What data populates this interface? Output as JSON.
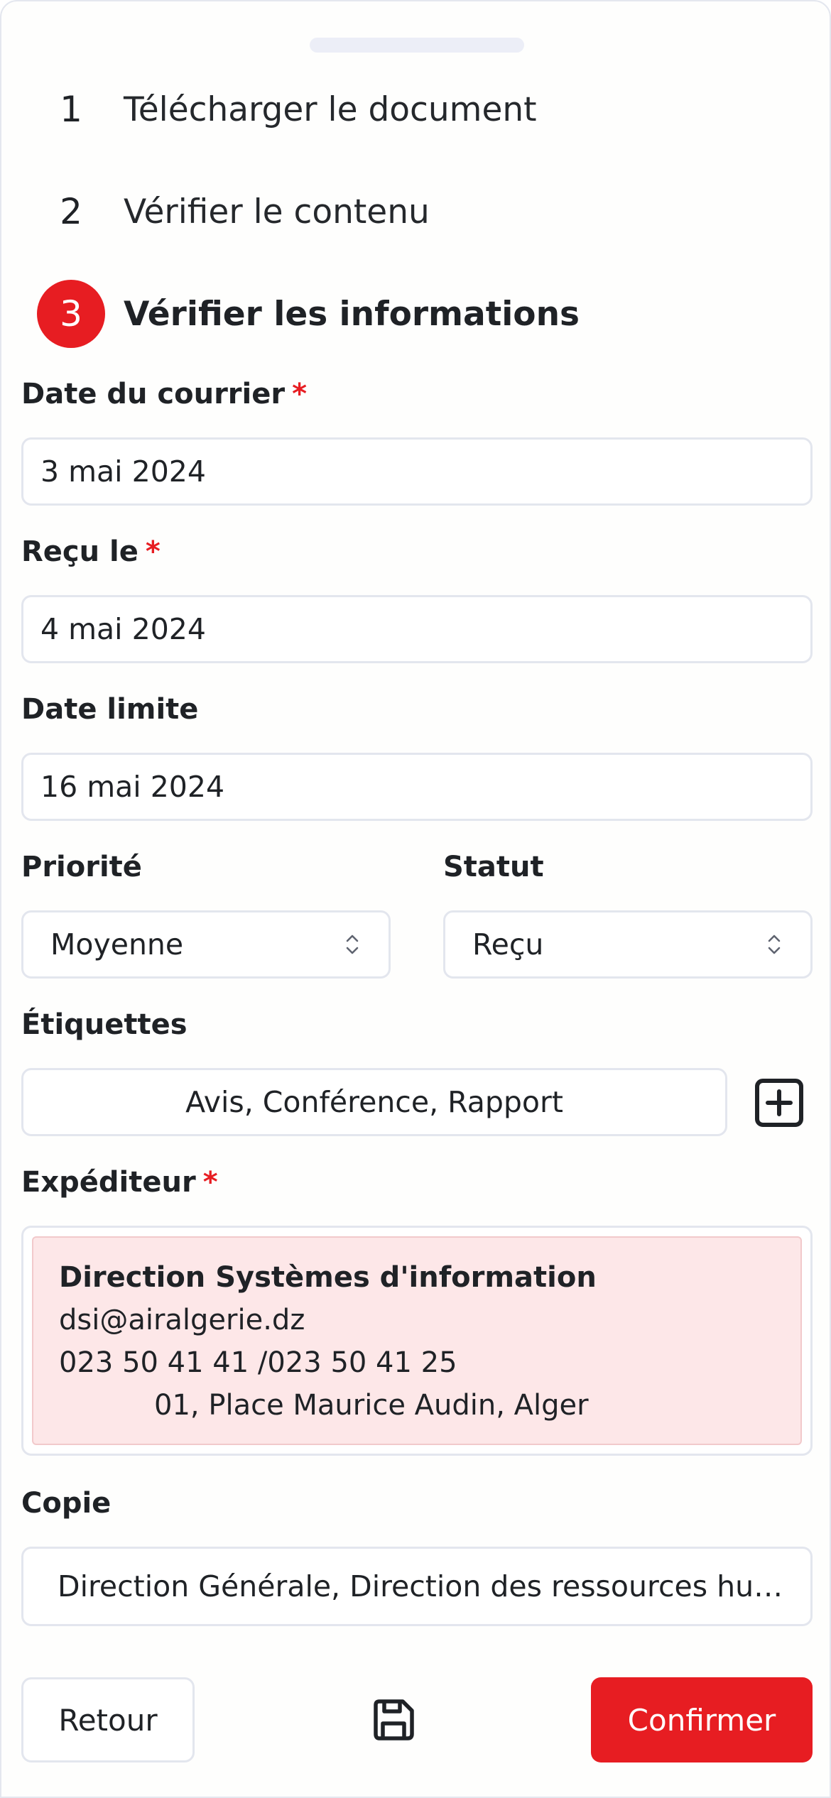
{
  "steps": [
    {
      "number": "1",
      "label": "Télécharger le document",
      "active": false
    },
    {
      "number": "2",
      "label": "Vérifier le contenu",
      "active": false
    },
    {
      "number": "3",
      "label": "Vérifier les informations",
      "active": true
    }
  ],
  "form": {
    "date_courrier": {
      "label": "Date du courrier",
      "required_mark": "*",
      "value": "3 mai 2024"
    },
    "recu_le": {
      "label": "Reçu le",
      "required_mark": "*",
      "value": "4 mai 2024"
    },
    "date_limite": {
      "label": "Date limite",
      "value": "16 mai 2024"
    },
    "priorite": {
      "label": "Priorité",
      "value": "Moyenne"
    },
    "statut": {
      "label": "Statut",
      "value": "Reçu"
    },
    "etiquettes": {
      "label": "Étiquettes",
      "value": "Avis, Conférence, Rapport"
    },
    "expediteur": {
      "label": "Expéditeur",
      "required_mark": "*",
      "name": "Direction Systèmes d'information",
      "email": "dsi@airalgerie.dz",
      "phone": "023 50 41 41 /023 50 41 25",
      "address": "01, Place Maurice Audin, Alger"
    },
    "copie": {
      "label": "Copie",
      "value": "Direction Générale, Direction des ressources humaines"
    }
  },
  "actions": {
    "back_label": "Retour",
    "save_icon": "save-icon",
    "confirm_label": "Confirmer"
  },
  "colors": {
    "accent": "#e71d22",
    "sender_bg": "#fde7e8",
    "border": "#e3e6ee"
  }
}
